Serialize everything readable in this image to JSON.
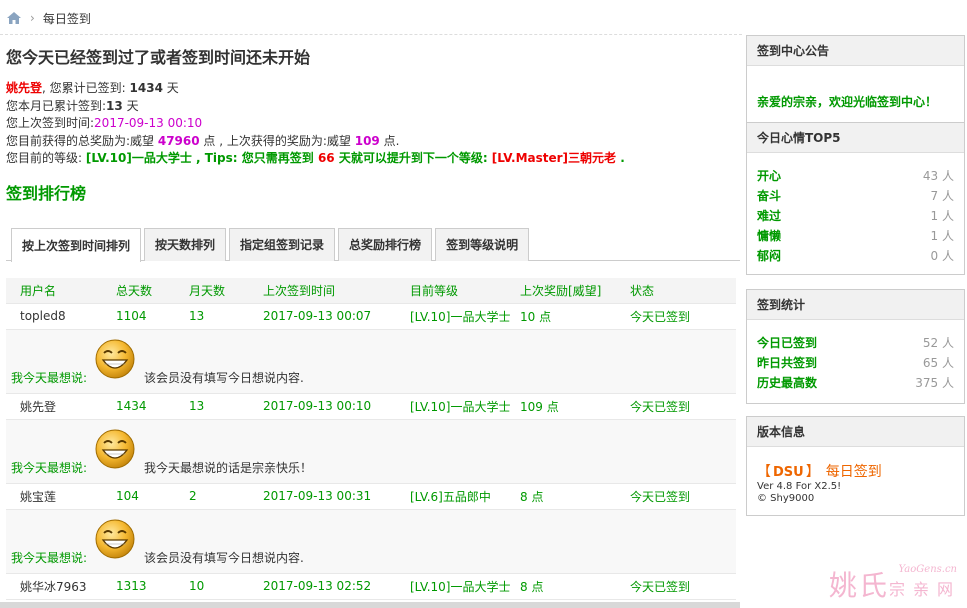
{
  "breadcrumb": {
    "current": "每日签到"
  },
  "status": {
    "title": "您今天已经签到过了或者签到时间还未开始",
    "username": "姚先登",
    "line1_pre": ", 您累计已签到: ",
    "total_days": "1434",
    "line1_post": " 天",
    "line2_pre": "您本月已累计签到:",
    "month_days": "13",
    "line2_post": " 天",
    "line3_pre": "您上次签到时间:",
    "last_time": "2017-09-13 00:10",
    "line4_pre": "您目前获得的总奖励为:威望 ",
    "total_reward": "47960",
    "line4_mid": " 点 , 上次获得的奖励为:威望 ",
    "last_reward": "109",
    "line4_post": " 点.",
    "line5_pre": "您目前的等级: ",
    "level": "[LV.10]一品大学士",
    "line5_tips": " , Tips: 您只需再签到 ",
    "days_needed": "66",
    "line5_mid": " 天就可以提升到下一个等级: ",
    "next_level": "[LV.Master]三朝元老",
    "line5_post": " ."
  },
  "ranking": {
    "title": "签到排行榜",
    "tabs": [
      "按上次签到时间排列",
      "按天数排列",
      "指定组签到记录",
      "总奖励排行榜",
      "签到等级说明"
    ],
    "columns": [
      "用户名",
      "总天数",
      "月天数",
      "上次签到时间",
      "目前等级",
      "上次奖励[威望]",
      "状态"
    ],
    "mood_label": "我今天最想说:",
    "rows": [
      {
        "name": "topled8",
        "total": "1104",
        "month": "13",
        "last": "2017-09-13 00:07",
        "level": "[LV.10]一品大学士",
        "reward": "10 点",
        "state": "今天已签到",
        "mood": "该会员没有填写今日想说内容."
      },
      {
        "name": "姚先登",
        "total": "1434",
        "month": "13",
        "last": "2017-09-13 00:10",
        "level": "[LV.10]一品大学士",
        "reward": "109 点",
        "state": "今天已签到",
        "mood": "我今天最想说的话是宗亲快乐！"
      },
      {
        "name": "姚宝莲",
        "total": "104",
        "month": "2",
        "last": "2017-09-13 00:31",
        "level": "[LV.6]五品郎中",
        "reward": "8 点",
        "state": "今天已签到",
        "mood": "该会员没有填写今日想说内容."
      },
      {
        "name": "姚华冰7963",
        "total": "1313",
        "month": "10",
        "last": "2017-09-13 02:52",
        "level": "[LV.10]一品大学士",
        "reward": "8 点",
        "state": "今天已签到"
      }
    ]
  },
  "sidebar": {
    "notice": {
      "title": "签到中心公告",
      "text": "亲爱的宗亲，欢迎光临签到中心！"
    },
    "mood": {
      "title": "今日心情TOP5",
      "items": [
        {
          "k": "开心",
          "v": "43 人"
        },
        {
          "k": "奋斗",
          "v": "7 人"
        },
        {
          "k": "难过",
          "v": "1 人"
        },
        {
          "k": "慵懒",
          "v": "1 人"
        },
        {
          "k": "郁闷",
          "v": "0 人"
        }
      ]
    },
    "stats": {
      "title": "签到统计",
      "items": [
        {
          "k": "今日已签到",
          "v": "52 人"
        },
        {
          "k": "昨日共签到",
          "v": "65 人"
        },
        {
          "k": "历史最高数",
          "v": "375 人"
        }
      ]
    },
    "version": {
      "title": "版本信息",
      "bracket_open": "【",
      "dsu": "DSU",
      "bracket_close": "】",
      "name": "每日签到",
      "ver": "Ver 4.8 For X2.5!",
      "copy": "© Shy9000"
    }
  },
  "watermark": {
    "big": "姚氏",
    "sub": "宗亲网",
    "site": "YaoGens.cn"
  },
  "colors": {
    "green": "#009900",
    "red": "#ee0000",
    "magenta": "#cc00cc",
    "orange": "#ee6600"
  }
}
